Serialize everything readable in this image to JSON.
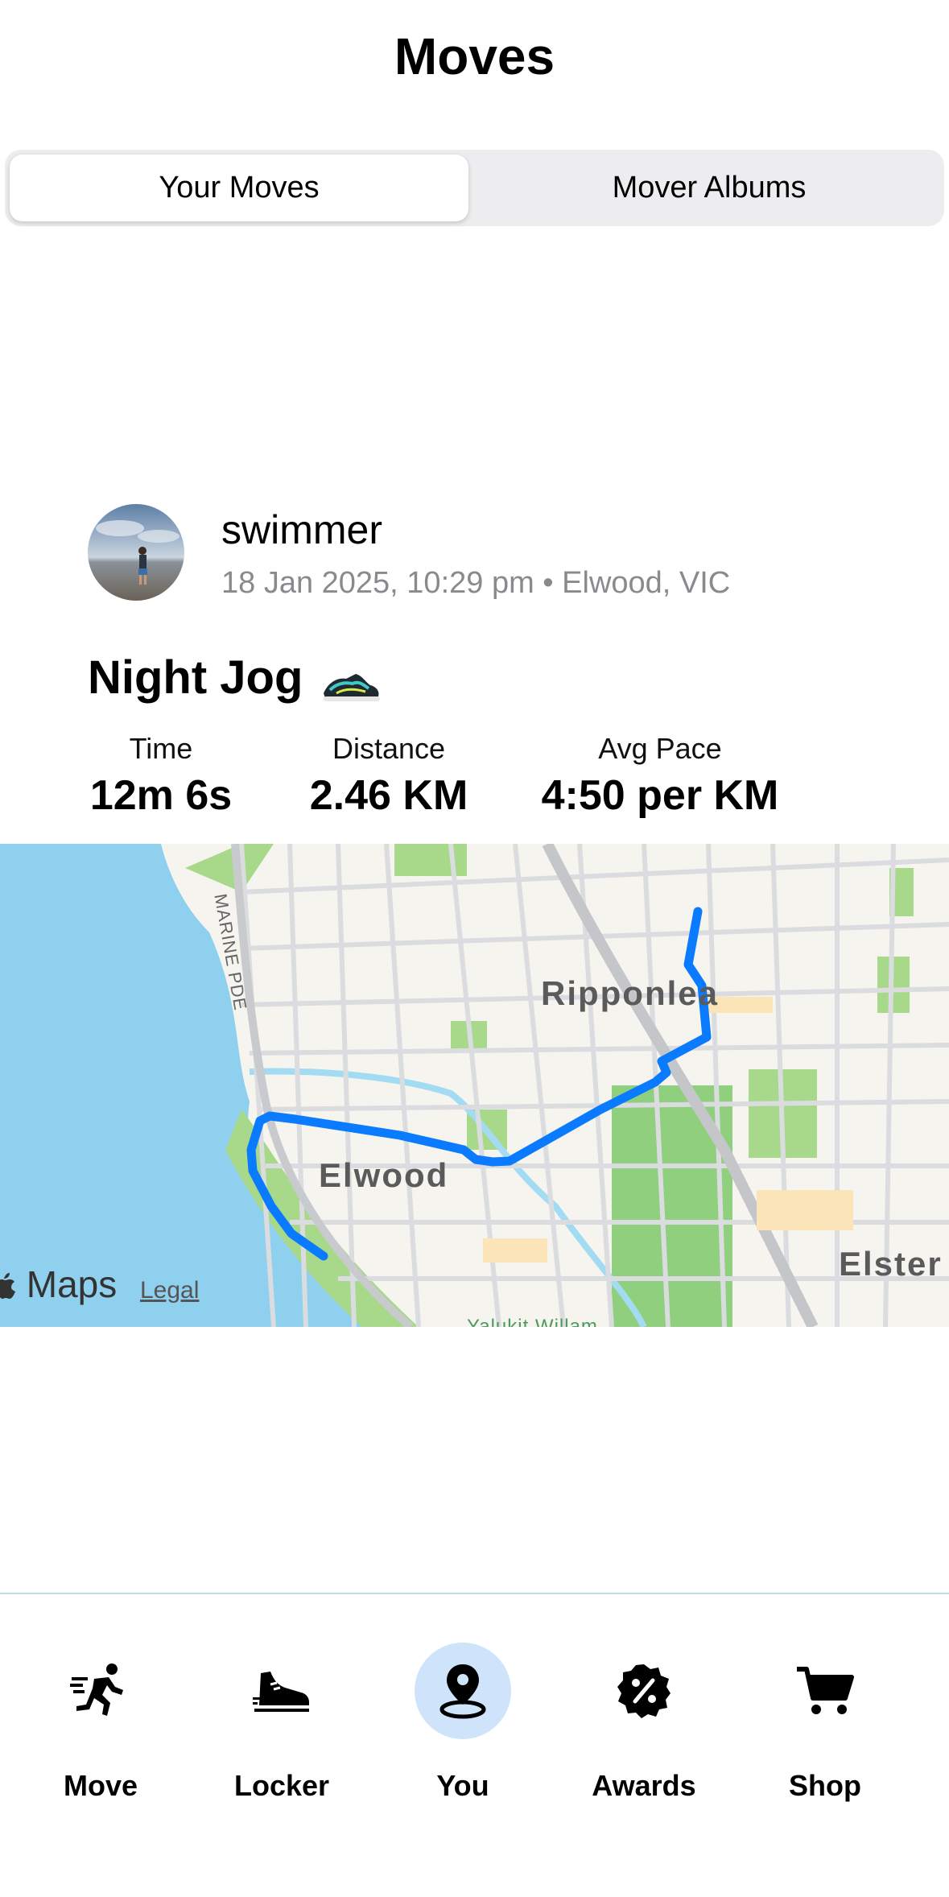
{
  "header": {
    "title": "Moves"
  },
  "segments": {
    "items": [
      {
        "label": "Your Moves",
        "selected": true
      },
      {
        "label": "Mover Albums",
        "selected": false
      }
    ]
  },
  "post": {
    "username": "swimmer",
    "meta": "18 Jan 2025, 10:29 pm • Elwood, VIC",
    "activity_title": "Night Jog",
    "stats": [
      {
        "label": "Time",
        "value": "12m 6s"
      },
      {
        "label": "Distance",
        "value": "2.46 KM"
      },
      {
        "label": "Avg Pace",
        "value": "4:50 per KM"
      }
    ]
  },
  "map": {
    "place_labels": [
      "Ripponlea",
      "Elwood",
      "Elster"
    ],
    "road_label": "MARINE PDE",
    "bottom_label": "Yalukit Willam",
    "brand": "Maps",
    "legal": "Legal",
    "route_color": "#0a7bff"
  },
  "tabbar": {
    "items": [
      {
        "label": "Move",
        "icon": "running-person-icon",
        "active": false
      },
      {
        "label": "Locker",
        "icon": "sneaker-icon",
        "active": false
      },
      {
        "label": "You",
        "icon": "location-pin-icon",
        "active": true
      },
      {
        "label": "Awards",
        "icon": "discount-badge-icon",
        "active": false
      },
      {
        "label": "Shop",
        "icon": "shopping-cart-icon",
        "active": false
      }
    ],
    "active_color": "#cfe3fb"
  }
}
